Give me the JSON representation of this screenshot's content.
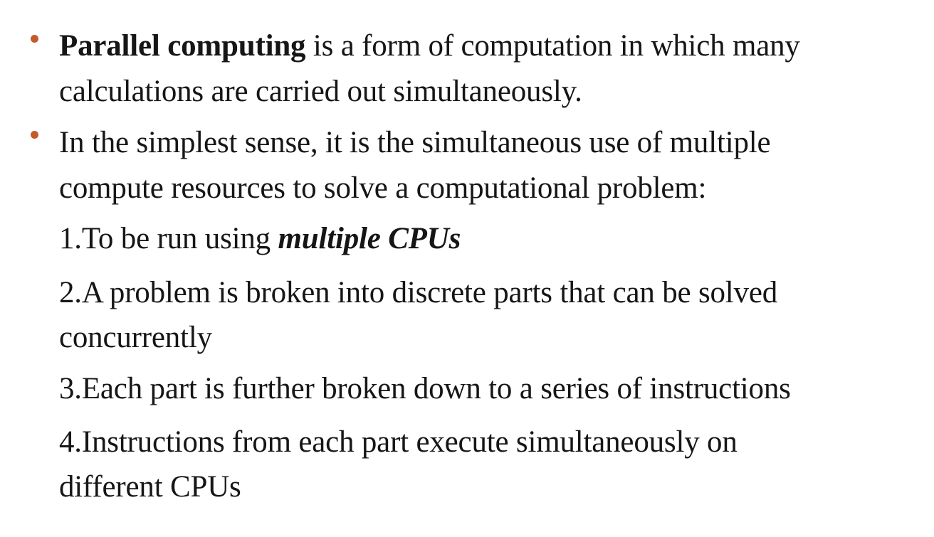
{
  "colors": {
    "bullet": "#c55a28",
    "text": "#161616",
    "background": "#ffffff"
  },
  "bullet1": {
    "bold_term": "Parallel computing",
    "line1_rest": " is a form of computation in which many",
    "line2": "calculations are carried out simultaneously."
  },
  "bullet2": {
    "line1": "In the simplest sense, it is the simultaneous use of multiple",
    "line2": "compute resources to solve a computational problem:"
  },
  "steps": {
    "step1_number": "1.",
    "step1_text": "To be run using ",
    "step1_emphasis": "multiple CPUs",
    "step2_number": "2.",
    "step2_line1": "A problem is broken into discrete parts that can be solved",
    "step2_line2": "concurrently",
    "step3_number": "3.",
    "step3_text": "Each part is further broken down to a series of instructions",
    "step4_number": "4.",
    "step4_line1": "Instructions from each part execute simultaneously on",
    "step4_line2": "different CPUs"
  }
}
